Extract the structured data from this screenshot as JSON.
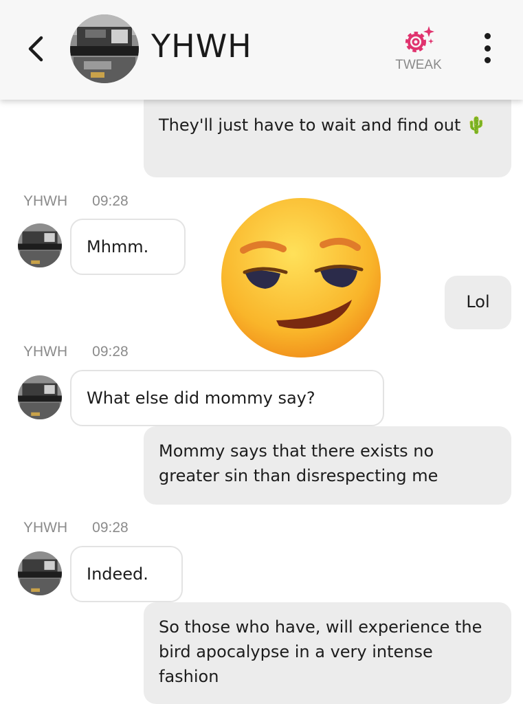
{
  "header": {
    "title": "YHWH",
    "tweak_label": "TWEAK",
    "accent_color": "#e0336e"
  },
  "messages": [
    {
      "from": "me",
      "text": "They'll just have to wait and find out 🌵"
    },
    {
      "from": "them",
      "sender": "YHWH",
      "time": "09:28",
      "text": "Mhmm."
    },
    {
      "from": "me",
      "emoji": "smirking-face"
    },
    {
      "from": "me",
      "text": "Lol"
    },
    {
      "from": "them",
      "sender": "YHWH",
      "time": "09:28",
      "text": "What else did mommy say?"
    },
    {
      "from": "me",
      "text": "Mommy says that there exists no greater sin than disrespecting me"
    },
    {
      "from": "them",
      "sender": "YHWH",
      "time": "09:28",
      "text": "Indeed."
    },
    {
      "from": "me",
      "text": "So those who have, will experience the bird apocalypse in a very intense fashion"
    }
  ]
}
